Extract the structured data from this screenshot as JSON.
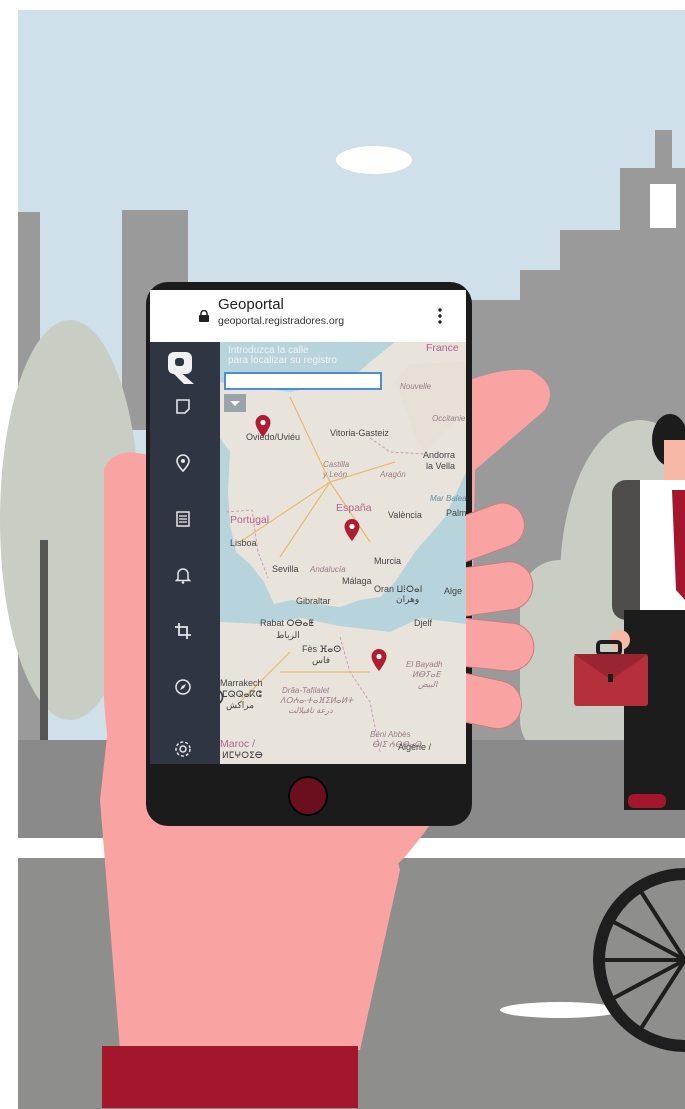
{
  "browser": {
    "title": "Geoportal",
    "url": "geoportal.registradores.org"
  },
  "search": {
    "hint_line1": "Introduzca la calle",
    "hint_line2": "para localizar su registro",
    "placeholder": ""
  },
  "sidebar": {
    "items": [
      {
        "icon": "note-icon"
      },
      {
        "icon": "location-pin-icon"
      },
      {
        "icon": "list-icon"
      },
      {
        "icon": "bell-icon"
      },
      {
        "icon": "crop-icon"
      },
      {
        "icon": "compass-icon"
      },
      {
        "icon": "settings-icon"
      }
    ]
  },
  "map": {
    "labels": {
      "france": "France",
      "nouvelle": "Nouvelle",
      "occitanie": "Occitanie",
      "oviedo": "Oviedo/Uviéu",
      "vitoria": "Vitoria-Gasteiz",
      "castilla": "Castilla",
      "leon": "y León",
      "aragon": "Aragón",
      "andorra1": "Andorra",
      "andorra2": "la Vella",
      "espana": "España",
      "valencia": "València",
      "portugal": "Portugal",
      "lisboa": "Lisboa",
      "sevilla": "Sevilla",
      "andalucia": "Andalucía",
      "murcia": "Murcia",
      "malaga": "Málaga",
      "oran": "Oran ⵡⵂⵔⴰⵏ",
      "oran_ar": "وهران",
      "gibraltar": "Gibraltar",
      "rabat": "Rabat ⵔⴱⴰⵟ",
      "rabat_ar": "الرباط",
      "fes": "Fès ⴼⴰⵙ",
      "fes_ar": "فاس",
      "marrakech": "Marrakech",
      "marrakech_tz": "ⵎⵕⵕⴰⴽⵛ",
      "marrakech_ar": "مراكش",
      "draa": "Drâa-Tafilalet",
      "draa_tz": "ⴷⵔⵄⴰ-ⵜⴰⴼⵉⵍⴰⵍⵜ",
      "draa_ar": "درعة تافيلالت",
      "elbayadh": "El Bayadh",
      "elbayadh_tz": "ⵍⴱⵢⴰⴹ",
      "elbayadh_ar": "البيض",
      "beniabbes": "Béni Abbès",
      "beniabbes_tz": "ⴱⵏⵉ ⵄⴱⴱⴰⵙ",
      "algerie": "Algérie /",
      "maroc": "Maroc /",
      "maroc_tz": "ⵍⵎⵖⵔⵉⴱ",
      "djelf": "Djelf",
      "alge": "Alge",
      "palm": "Palm",
      "mar": "Mar Balear"
    }
  },
  "colors": {
    "sky": "#cfe0ea",
    "hand": "#f9a3a3",
    "sleeve": "#a3162c",
    "sidebar": "#2f3542",
    "pin": "#b01d33",
    "bezel": "#1b1b1b"
  }
}
